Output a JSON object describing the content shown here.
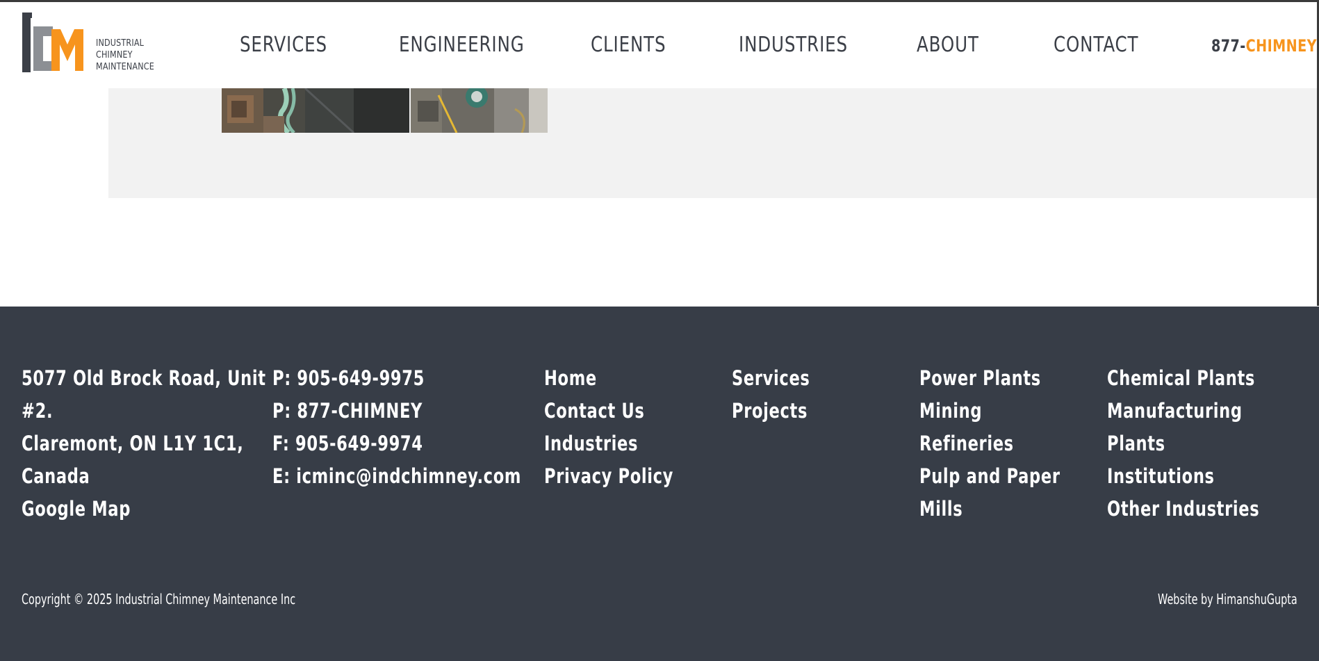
{
  "colors": {
    "brand_orange": "#f7941d",
    "brand_gray": "#3b3f47",
    "footer_bg": "#373d47",
    "band_bg": "#f2f2f2"
  },
  "logo": {
    "letters": "ICM",
    "lines": [
      "INDUSTRIAL",
      "CHIMNEY",
      "MAINTENANCE"
    ]
  },
  "nav": {
    "items": [
      "SERVICES",
      "ENGINEERING",
      "CLIENTS",
      "INDUSTRIES",
      "ABOUT",
      "CONTACT"
    ],
    "phone_number": "877-",
    "phone_word": "CHIMNEY"
  },
  "footer": {
    "address": [
      "5077 Old Brock Road, Unit",
      "#2.",
      "Claremont, ON L1Y 1C1,",
      "Canada",
      "Google Map"
    ],
    "contact": [
      "P: 905-649-9975",
      "P: 877-CHIMNEY",
      "F: 905-649-9974",
      "E: icminc@indchimney.com"
    ],
    "links_a": [
      "Home",
      "Contact Us",
      "Industries",
      "Privacy Policy"
    ],
    "links_b": [
      "Services",
      "Projects"
    ],
    "industries_a": [
      "Power Plants",
      "Mining",
      "Refineries",
      "Pulp and Paper",
      "Mills"
    ],
    "industries_b": [
      "Chemical Plants",
      "Manufacturing",
      "Plants",
      "Institutions",
      "Other Industries"
    ],
    "copyright": "Copyright © 2025 Industrial Chimney Maintenance Inc",
    "credit": "Website by HimanshuGupta"
  }
}
